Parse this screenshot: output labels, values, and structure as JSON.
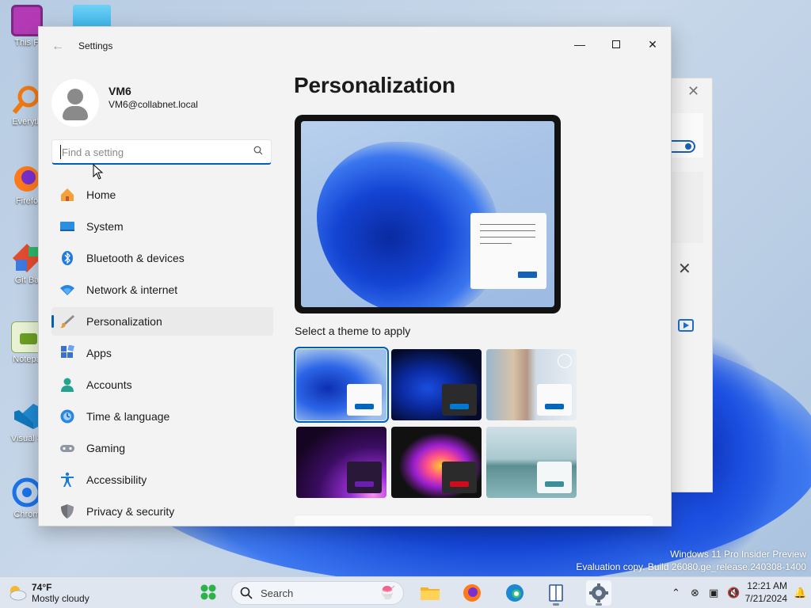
{
  "desktop": {
    "icons": [
      {
        "label": "This P",
        "icon": "this-pc-icon"
      },
      {
        "label": "Everyth",
        "icon": "everything-search-icon"
      },
      {
        "label": "Firefo",
        "icon": "firefox-icon"
      },
      {
        "label": "Git Ba",
        "icon": "git-bash-icon"
      },
      {
        "label": "Notepa",
        "icon": "notepad-plus-icon"
      },
      {
        "label": "Visual S",
        "icon": "vscode-icon"
      },
      {
        "label": "Chrom",
        "icon": "chrome-icon"
      }
    ],
    "watermark_line1": "Windows 11 Pro Insider Preview",
    "watermark_line2": "Evaluation copy. Build 26080.ge_release.240308-1400"
  },
  "settings": {
    "app_title": "Settings",
    "user": {
      "name": "VM6",
      "email": "VM6@collabnet.local"
    },
    "search": {
      "placeholder": "Find a setting",
      "value": ""
    },
    "nav": [
      {
        "label": "Home",
        "icon": "home-icon"
      },
      {
        "label": "System",
        "icon": "system-icon"
      },
      {
        "label": "Bluetooth & devices",
        "icon": "bluetooth-icon"
      },
      {
        "label": "Network & internet",
        "icon": "network-icon"
      },
      {
        "label": "Personalization",
        "icon": "personalization-icon",
        "active": true
      },
      {
        "label": "Apps",
        "icon": "apps-icon"
      },
      {
        "label": "Accounts",
        "icon": "accounts-icon"
      },
      {
        "label": "Time & language",
        "icon": "time-language-icon"
      },
      {
        "label": "Gaming",
        "icon": "gaming-icon"
      },
      {
        "label": "Accessibility",
        "icon": "accessibility-icon"
      },
      {
        "label": "Privacy & security",
        "icon": "privacy-icon"
      }
    ],
    "page_title": "Personalization",
    "theme_section_label": "Select a theme to apply",
    "themes": [
      {
        "name": "windows-light",
        "selected": true,
        "accent": "#0067c0"
      },
      {
        "name": "windows-dark",
        "selected": false,
        "accent": "#0078d4"
      },
      {
        "name": "glow",
        "selected": false,
        "accent": "#0067c0"
      },
      {
        "name": "captured-motion",
        "selected": false,
        "accent": "#6b1fb0"
      },
      {
        "name": "flow",
        "selected": false,
        "accent": "#d10b1b"
      },
      {
        "name": "sunrise",
        "selected": false,
        "accent": "#3b8f9a"
      }
    ],
    "accent_color": "#005fb8"
  },
  "taskbar": {
    "weather_temp": "74°F",
    "weather_desc": "Mostly cloudy",
    "search_placeholder": "Search",
    "apps": [
      "start-icon",
      "file-explorer-icon",
      "firefox-icon",
      "edge-icon",
      "reader-icon",
      "settings-icon"
    ],
    "clock_time": "12:21 AM",
    "clock_date": "7/21/2024"
  }
}
